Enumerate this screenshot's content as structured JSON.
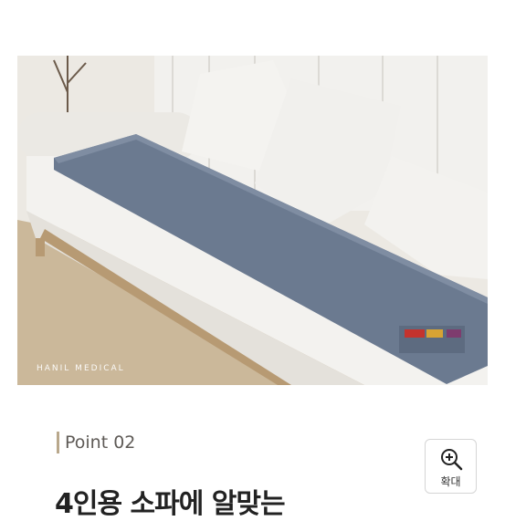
{
  "product_image": {
    "alt": "Heated mat on white sofa",
    "watermark": "HANIL MEDICAL"
  },
  "section": {
    "point_label": "Point 02",
    "headline": "4인용 소파에 알맞는"
  },
  "zoom_button": {
    "label": "확대",
    "icon": "zoom-in-icon"
  }
}
